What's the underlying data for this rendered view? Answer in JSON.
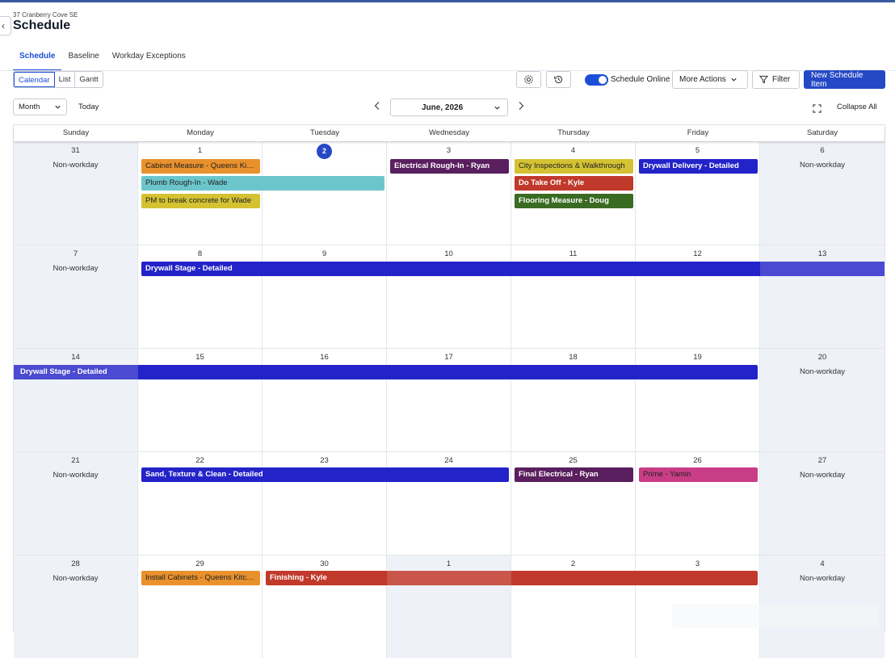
{
  "header": {
    "address": "37 Cranberry Cove SE",
    "title": "Schedule",
    "back_icon": "chevron-left-icon"
  },
  "tabs": [
    {
      "label": "Schedule",
      "active": true
    },
    {
      "label": "Baseline",
      "active": false
    },
    {
      "label": "Workday Exceptions",
      "active": false
    }
  ],
  "view_toggle": {
    "calendar": "Calendar",
    "list": "List",
    "gantt": "Gantt",
    "selected": "Calendar"
  },
  "toolbar": {
    "settings_icon": "gear-icon",
    "history_icon": "history-icon",
    "schedule_online_label": "Schedule Online",
    "schedule_online_on": true,
    "more_actions_label": "More Actions",
    "filter_label": "Filter",
    "new_item_label": "New Schedule Item",
    "accent": "#2548c6"
  },
  "nav": {
    "range_select": "Month",
    "today_label": "Today",
    "current_month": "June, 2026",
    "collapse_all_label": "Collapse All"
  },
  "calendar": {
    "days_of_week": [
      "Sunday",
      "Monday",
      "Tuesday",
      "Wednesday",
      "Thursday",
      "Friday",
      "Saturday"
    ],
    "non_workday_label": "Non-workday",
    "weeks": [
      {
        "days": [
          "31",
          "1",
          "2",
          "3",
          "4",
          "5",
          "6"
        ],
        "nonwork": [
          true,
          false,
          false,
          false,
          false,
          false,
          true
        ]
      },
      {
        "days": [
          "7",
          "8",
          "9",
          "10",
          "11",
          "12",
          "13"
        ],
        "nonwork": [
          true,
          false,
          false,
          false,
          false,
          false,
          false
        ]
      },
      {
        "days": [
          "14",
          "15",
          "16",
          "17",
          "18",
          "19",
          "20"
        ],
        "nonwork": [
          false,
          false,
          false,
          false,
          false,
          false,
          true
        ]
      },
      {
        "days": [
          "21",
          "22",
          "23",
          "24",
          "25",
          "26",
          "27"
        ],
        "nonwork": [
          true,
          false,
          false,
          false,
          false,
          false,
          true
        ]
      },
      {
        "days": [
          "28",
          "29",
          "30",
          "1",
          "2",
          "3",
          "4"
        ],
        "nonwork": [
          true,
          false,
          false,
          false,
          false,
          false,
          true
        ]
      }
    ],
    "events": {
      "cabinet_measure": {
        "label": "Cabinet Measure - Queens Kitchen",
        "color": "#e8912d"
      },
      "plumb_rough": {
        "label": "Plumb Rough-In - Wade",
        "color": "#6bc6cc"
      },
      "pm_concrete": {
        "label": "PM to break concrete for Wade",
        "color": "#d4c233"
      },
      "electrical_rough": {
        "label": "Electrical Rough-In - Ryan",
        "color": "#5a1f5e"
      },
      "city_inspections": {
        "label": "City Inspections & Walkthrough",
        "color": "#d4c233"
      },
      "do_take_off": {
        "label": "Do Take Off - Kyle",
        "color": "#c0392b"
      },
      "flooring_measure": {
        "label": "Flooring Measure - Doug",
        "color": "#3a6b22"
      },
      "drywall_delivery": {
        "label": "Drywall Delivery - Detailed",
        "color": "#2323c9"
      },
      "drywall_stage_1": {
        "label": "Drywall Stage - Detailed",
        "color": "#2323c9"
      },
      "drywall_stage_2": {
        "label": "Drywall Stage - Detailed",
        "color": "#2323c9"
      },
      "sand_texture": {
        "label": "Sand, Texture & Clean - Detailed",
        "color": "#2323c9"
      },
      "final_electrical": {
        "label": "Final Electrical - Ryan",
        "color": "#5a1f5e"
      },
      "prime": {
        "label": "Prime - Yamin",
        "color": "#c83d86"
      },
      "install_cabinets": {
        "label": "Install Cabinets - Queens Kitchen",
        "color": "#e8912d"
      },
      "finishing": {
        "label": "Finishing - Kyle",
        "color": "#c0392b"
      }
    }
  }
}
